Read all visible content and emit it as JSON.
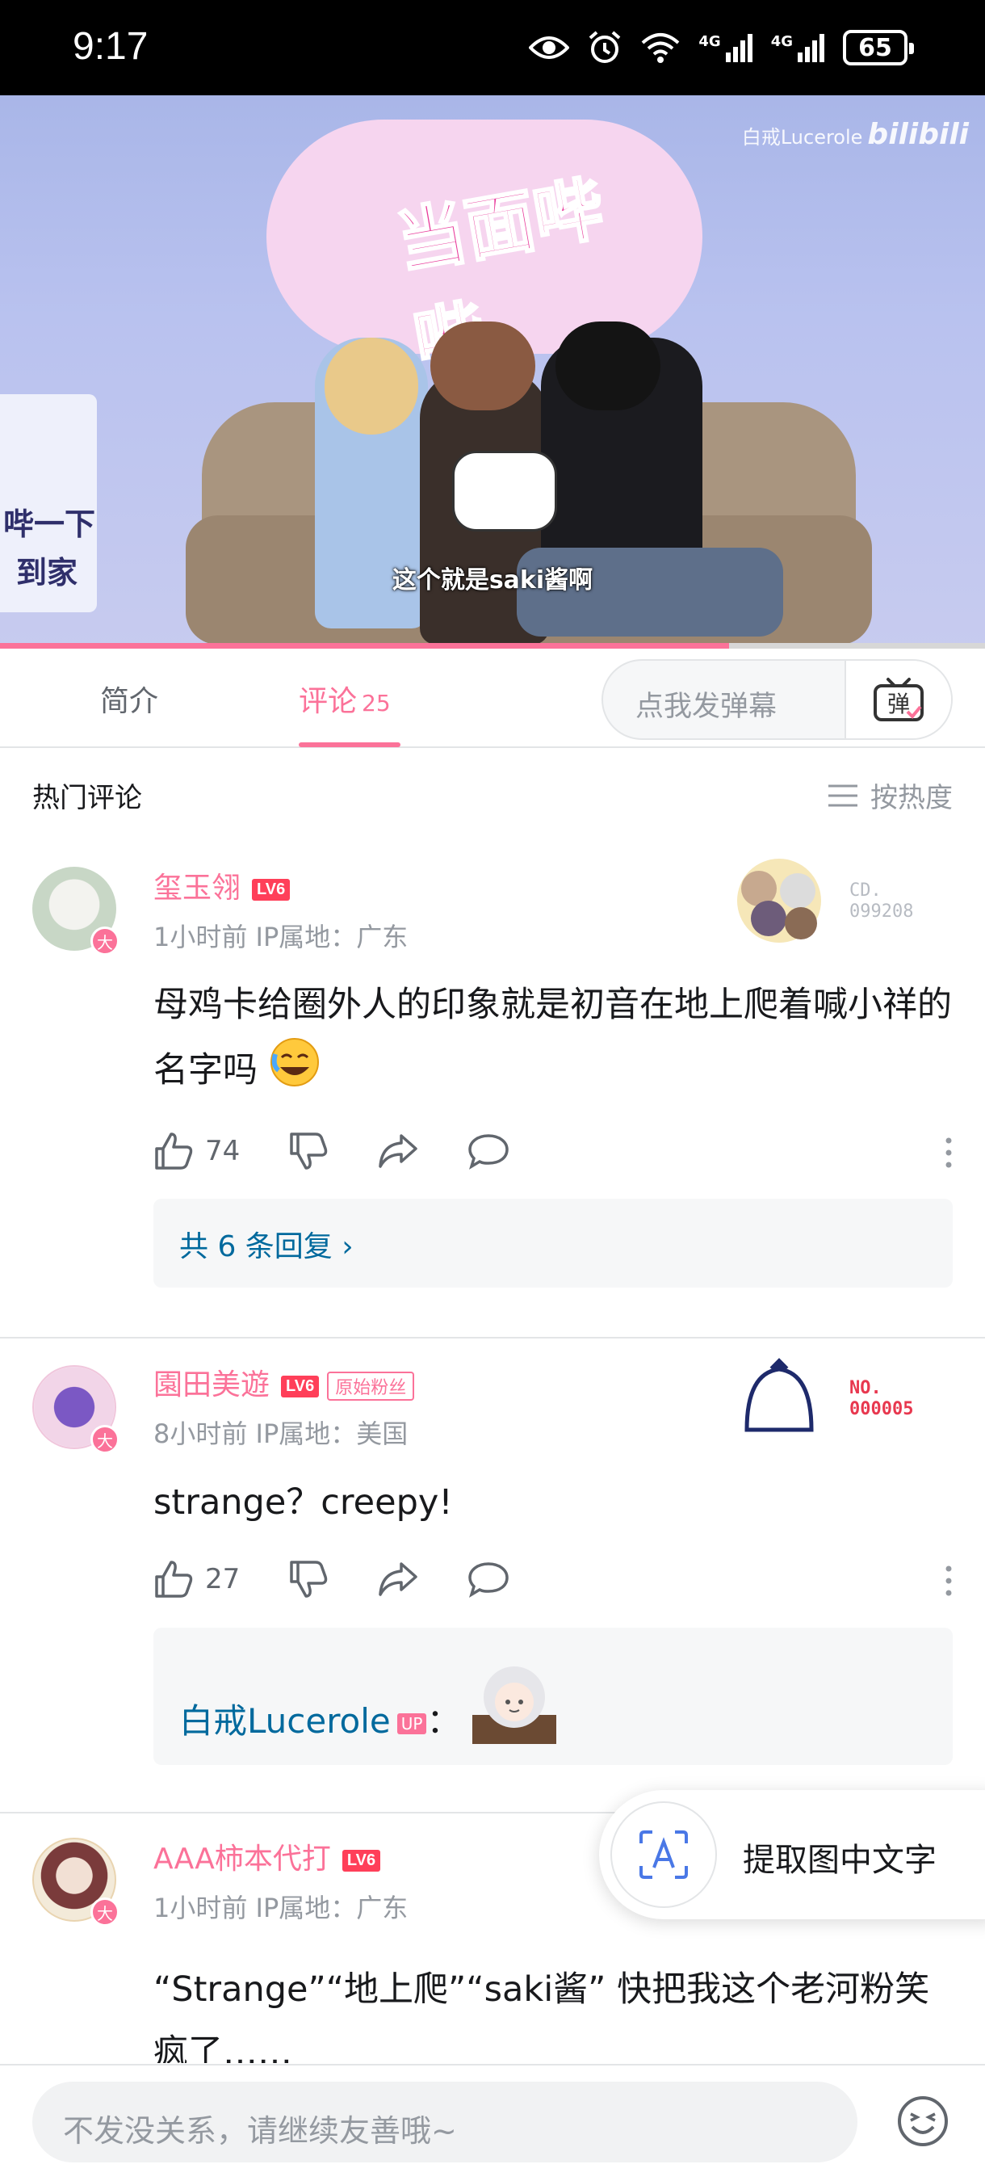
{
  "status_bar": {
    "time": "9:17",
    "battery": "65",
    "net1": "4G",
    "net2": "4G"
  },
  "video": {
    "show_logo": "当面哔哔",
    "watermark_user": "白戒Lucerole",
    "watermark_brand": "bilibili",
    "side_text_1": "哔一下",
    "side_text_2": "到家",
    "subtitle": "这个就是saki酱啊",
    "progress": 0.74
  },
  "tabs": {
    "intro": "简介",
    "comments": "评论",
    "comment_count": "25"
  },
  "danmaku": {
    "placeholder": "点我发弹幕",
    "button": "弹"
  },
  "list_header": {
    "hot": "热门评论",
    "sort": "按热度"
  },
  "comments": [
    {
      "user": "玺玉翎",
      "level": "LV6",
      "time": "1小时前",
      "ip": "IP属地：广东",
      "content": "母鸡卡给圈外人的印象就是初音在地上爬着喊小祥的名字吗",
      "likes": "74",
      "replies": "共 6 条回复 ›",
      "decor_line1": "CD.",
      "decor_line2": "099208"
    },
    {
      "user": "園田美遊",
      "level": "LV6",
      "badge": "原始粉丝",
      "time": "8小时前",
      "ip": "IP属地：美国",
      "content": "strange？creepy!",
      "likes": "27",
      "reply_user": "白戒Lucerole",
      "reply_tag": "UP",
      "reply_colon": "：",
      "decor_line1": "NO.",
      "decor_line2": "000005"
    },
    {
      "user": "AAA柿本代打",
      "level": "LV6",
      "time": "1小时前",
      "ip": "IP属地：广东",
      "content": "“Strange”“地上爬”“saki酱” 快把我这个老河粉笑疯了……"
    }
  ],
  "ocr": {
    "label": "提取图中文字"
  },
  "input": {
    "placeholder": "不发没关系，请继续友善哦~"
  },
  "colors": {
    "accent": "#fb7299",
    "link": "#00699d",
    "level": "#ff3f59",
    "muted": "#9499a0"
  }
}
